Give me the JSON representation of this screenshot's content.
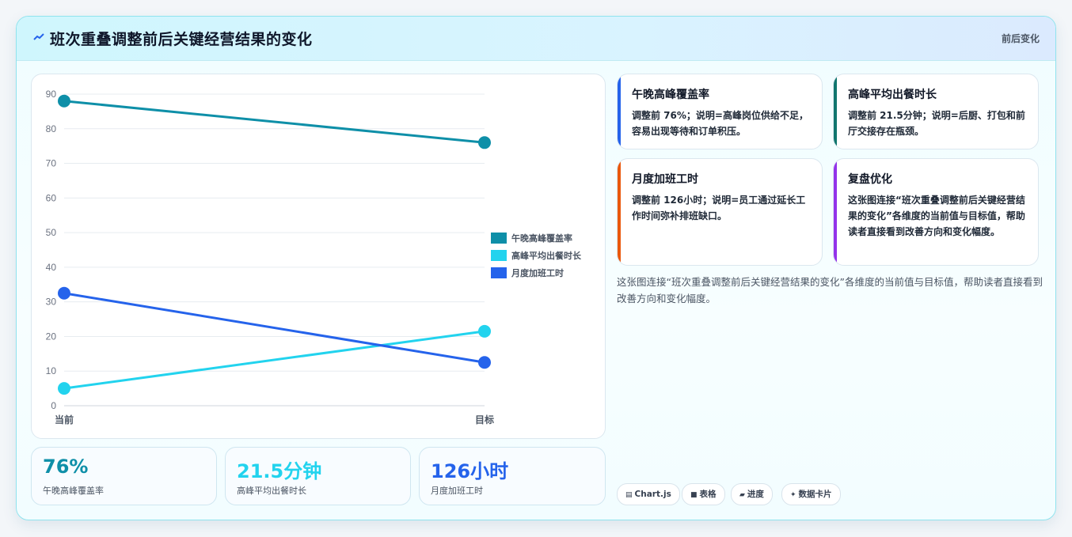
{
  "header": {
    "title": "班次重叠调整前后关键经营结果的变化",
    "tag": "前后变化"
  },
  "colors": {
    "s1": "#0e8fa8",
    "s2": "#22d3ee",
    "s3": "#2563eb"
  },
  "chart_data": {
    "type": "line",
    "x": [
      "当前",
      "目标"
    ],
    "ylim": [
      0,
      90
    ],
    "yticks": [
      0,
      10,
      20,
      30,
      40,
      50,
      60,
      70,
      80,
      90
    ],
    "grid": true,
    "legend": "right",
    "series": [
      {
        "name": "午晚高峰覆盖率",
        "values": [
          88,
          76
        ],
        "color": "#0e8fa8"
      },
      {
        "name": "高峰平均出餐时长",
        "values": [
          5,
          21.5
        ],
        "color": "#22d3ee"
      },
      {
        "name": "月度加班工时",
        "values": [
          32.5,
          12.5
        ],
        "color": "#2563eb"
      }
    ]
  },
  "kpis": [
    {
      "value": "76%",
      "label": "午晚高峰覆盖率",
      "color": "#0e8fa8"
    },
    {
      "value": "21.5分钟",
      "label": "高峰平均出餐时长",
      "color": "#22d3ee"
    },
    {
      "value": "126小时",
      "label": "月度加班工时",
      "color": "#2563eb"
    }
  ],
  "cards": [
    {
      "title": "午晚高峰覆盖率",
      "body": "调整前 76%；说明=高峰岗位供给不足，容易出现等待和订单积压。",
      "color": "#2563eb"
    },
    {
      "title": "高峰平均出餐时长",
      "body": "调整前 21.5分钟；说明=后厨、打包和前厅交接存在瓶颈。",
      "color": "#0f766e"
    },
    {
      "title": "月度加班工时",
      "body": "调整前 126小时；说明=员工通过延长工作时间弥补排班缺口。",
      "color": "#ea580c"
    },
    {
      "title": "复盘优化",
      "body": "这张图连接“班次重叠调整前后关键经营结果的变化”各维度的当前值与目标值，帮助读者直接看到改善方向和变化幅度。",
      "color": "#9333ea"
    }
  ],
  "summary": "这张图连接“班次重叠调整前后关键经营结果的变化”各维度的当前值与目标值，帮助读者直接看到改善方向和变化幅度。",
  "chips": [
    {
      "icon": "▤",
      "label": "Chart.js"
    },
    {
      "icon": "■",
      "label": "表格"
    },
    {
      "icon": "▰",
      "label": "进度"
    },
    {
      "icon": "✦",
      "label": "数据卡片"
    }
  ]
}
